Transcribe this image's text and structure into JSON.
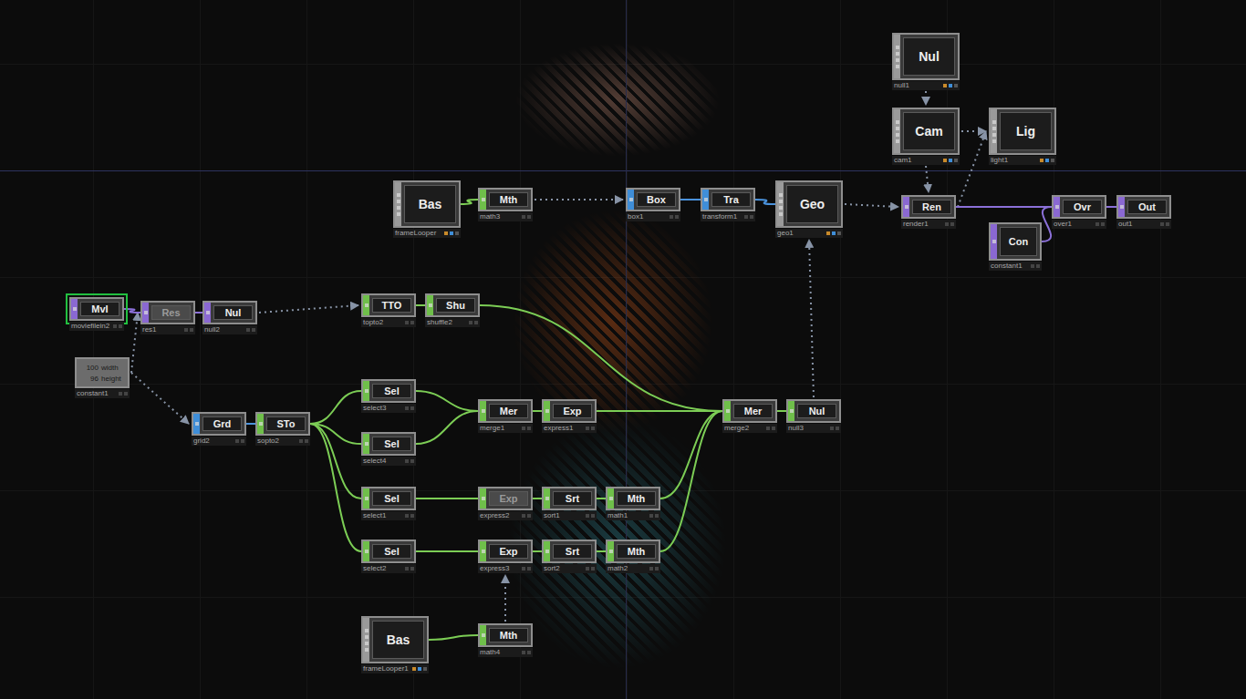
{
  "editor": {
    "nodes": [
      {
        "label": "Nul",
        "name": "null1",
        "kind": "comp",
        "selected": false,
        "dimmed": false
      },
      {
        "label": "Cam",
        "name": "cam1",
        "kind": "comp",
        "selected": false,
        "dimmed": false
      },
      {
        "label": "Lig",
        "name": "light1",
        "kind": "comp",
        "selected": false,
        "dimmed": false
      },
      {
        "label": "Bas",
        "name": "frameLooper",
        "kind": "comp",
        "selected": false,
        "dimmed": false
      },
      {
        "label": "Mth",
        "name": "math3",
        "kind": "chop",
        "selected": false,
        "dimmed": false
      },
      {
        "label": "Box",
        "name": "box1",
        "kind": "sop",
        "selected": false,
        "dimmed": false
      },
      {
        "label": "Tra",
        "name": "transform1",
        "kind": "sop",
        "selected": false,
        "dimmed": false
      },
      {
        "label": "Geo",
        "name": "geo1",
        "kind": "comp",
        "selected": false,
        "dimmed": false
      },
      {
        "label": "Ren",
        "name": "render1",
        "kind": "top",
        "selected": false,
        "dimmed": false
      },
      {
        "label": "Ovr",
        "name": "over1",
        "kind": "top",
        "selected": false,
        "dimmed": false
      },
      {
        "label": "Out",
        "name": "out1",
        "kind": "top",
        "selected": false,
        "dimmed": false
      },
      {
        "label": "Con",
        "name": "constant1",
        "kind": "top",
        "selected": false,
        "dimmed": false
      },
      {
        "label": "MvI",
        "name": "moviefilein2",
        "kind": "top",
        "selected": true,
        "dimmed": false
      },
      {
        "label": "Res",
        "name": "res1",
        "kind": "top",
        "selected": false,
        "dimmed": true
      },
      {
        "label": "Nul",
        "name": "null2",
        "kind": "top",
        "selected": false,
        "dimmed": false
      },
      {
        "label": "",
        "name": "constant1",
        "kind": "viewer",
        "selected": false,
        "dimmed": false,
        "rows": [
          {
            "value": "100",
            "label": "width"
          },
          {
            "value": "96",
            "label": "height"
          }
        ]
      },
      {
        "label": "TTO",
        "name": "topto2",
        "kind": "chop",
        "selected": false,
        "dimmed": false
      },
      {
        "label": "Shu",
        "name": "shuffle2",
        "kind": "chop",
        "selected": false,
        "dimmed": false
      },
      {
        "label": "Grd",
        "name": "grid2",
        "kind": "sop",
        "selected": false,
        "dimmed": false
      },
      {
        "label": "STo",
        "name": "sopto2",
        "kind": "chop",
        "selected": false,
        "dimmed": false
      },
      {
        "label": "Sel",
        "name": "select3",
        "kind": "chop",
        "selected": false,
        "dimmed": false
      },
      {
        "label": "Sel",
        "name": "select4",
        "kind": "chop",
        "selected": false,
        "dimmed": false
      },
      {
        "label": "Sel",
        "name": "select1",
        "kind": "chop",
        "selected": false,
        "dimmed": false
      },
      {
        "label": "Sel",
        "name": "select2",
        "kind": "chop",
        "selected": false,
        "dimmed": false
      },
      {
        "label": "Mer",
        "name": "merge1",
        "kind": "chop",
        "selected": false,
        "dimmed": false
      },
      {
        "label": "Exp",
        "name": "express1",
        "kind": "chop",
        "selected": false,
        "dimmed": false
      },
      {
        "label": "Exp",
        "name": "express2",
        "kind": "chop",
        "selected": false,
        "dimmed": true
      },
      {
        "label": "Srt",
        "name": "sort1",
        "kind": "chop",
        "selected": false,
        "dimmed": false
      },
      {
        "label": "Mth",
        "name": "math1",
        "kind": "chop",
        "selected": false,
        "dimmed": false
      },
      {
        "label": "Exp",
        "name": "express3",
        "kind": "chop",
        "selected": false,
        "dimmed": false
      },
      {
        "label": "Srt",
        "name": "sort2",
        "kind": "chop",
        "selected": false,
        "dimmed": false
      },
      {
        "label": "Mth",
        "name": "math2",
        "kind": "chop",
        "selected": false,
        "dimmed": false
      },
      {
        "label": "Mer",
        "name": "merge2",
        "kind": "chop",
        "selected": false,
        "dimmed": false
      },
      {
        "label": "Nul",
        "name": "null3",
        "kind": "chop",
        "selected": false,
        "dimmed": false
      },
      {
        "label": "Bas",
        "name": "frameLooper1",
        "kind": "comp",
        "selected": false,
        "dimmed": false
      },
      {
        "label": "Mth",
        "name": "math4",
        "kind": "chop",
        "selected": false,
        "dimmed": false
      }
    ],
    "links": [
      {
        "from": 0,
        "to": 1,
        "kind": "ref"
      },
      {
        "from": 1,
        "to": 2,
        "kind": "ref"
      },
      {
        "from": 1,
        "to": 8,
        "kind": "ref"
      },
      {
        "from": 8,
        "to": 2,
        "kind": "ref"
      },
      {
        "from": 4,
        "to": 5,
        "kind": "ref"
      },
      {
        "from": 7,
        "to": 8,
        "kind": "ref"
      },
      {
        "from": 33,
        "to": 7,
        "kind": "ref"
      },
      {
        "from": 14,
        "to": 16,
        "kind": "ref"
      },
      {
        "from": 15,
        "to": 13,
        "kind": "ref"
      },
      {
        "from": 15,
        "to": 18,
        "kind": "ref"
      },
      {
        "from": 35,
        "to": 29,
        "kind": "ref"
      },
      {
        "from": 3,
        "to": 4,
        "kind": "chop"
      },
      {
        "from": 5,
        "to": 6,
        "kind": "sop"
      },
      {
        "from": 6,
        "to": 7,
        "kind": "sop"
      },
      {
        "from": 8,
        "to": 9,
        "kind": "top"
      },
      {
        "from": 11,
        "to": 9,
        "kind": "top"
      },
      {
        "from": 9,
        "to": 10,
        "kind": "top"
      },
      {
        "from": 12,
        "to": 13,
        "kind": "top"
      },
      {
        "from": 13,
        "to": 14,
        "kind": "top"
      },
      {
        "from": 16,
        "to": 17,
        "kind": "chop"
      },
      {
        "from": 18,
        "to": 19,
        "kind": "sop"
      },
      {
        "from": 19,
        "to": 20,
        "kind": "chop"
      },
      {
        "from": 19,
        "to": 21,
        "kind": "chop"
      },
      {
        "from": 19,
        "to": 22,
        "kind": "chop"
      },
      {
        "from": 19,
        "to": 23,
        "kind": "chop"
      },
      {
        "from": 20,
        "to": 24,
        "kind": "chop"
      },
      {
        "from": 21,
        "to": 24,
        "kind": "chop"
      },
      {
        "from": 24,
        "to": 25,
        "kind": "chop"
      },
      {
        "from": 22,
        "to": 26,
        "kind": "chop"
      },
      {
        "from": 26,
        "to": 27,
        "kind": "chop"
      },
      {
        "from": 27,
        "to": 28,
        "kind": "chop"
      },
      {
        "from": 23,
        "to": 29,
        "kind": "chop"
      },
      {
        "from": 29,
        "to": 30,
        "kind": "chop"
      },
      {
        "from": 30,
        "to": 31,
        "kind": "chop"
      },
      {
        "from": 25,
        "to": 32,
        "kind": "chop"
      },
      {
        "from": 17,
        "to": 32,
        "kind": "chop"
      },
      {
        "from": 28,
        "to": 32,
        "kind": "chop"
      },
      {
        "from": 31,
        "to": 32,
        "kind": "chop"
      },
      {
        "from": 32,
        "to": 33,
        "kind": "chop"
      },
      {
        "from": 34,
        "to": 35,
        "kind": "chop"
      }
    ]
  }
}
